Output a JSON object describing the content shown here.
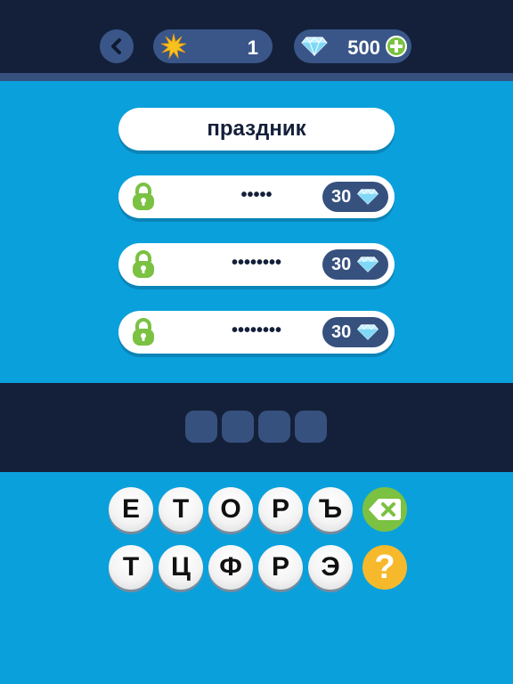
{
  "header": {
    "level_value": "1",
    "gems_value": "500"
  },
  "word": "праздник",
  "hints": [
    {
      "mask": "•••••",
      "price": "30"
    },
    {
      "mask": "••••••••",
      "price": "30"
    },
    {
      "mask": "••••••••",
      "price": "30"
    }
  ],
  "keyboard": {
    "row1": [
      "Е",
      "Т",
      "О",
      "Р",
      "Ъ"
    ],
    "row2": [
      "Т",
      "Ц",
      "Ф",
      "Р",
      "Э"
    ],
    "help_symbol": "?"
  },
  "icons": {
    "back": "chevron-left-icon",
    "level": "star-burst-icon",
    "gems": "diamond-icon",
    "add": "plus-icon",
    "lock": "padlock-icon",
    "delete": "delete-icon",
    "help": "question-icon"
  },
  "colors": {
    "background": "#0aa0dc",
    "dark_bar": "#14203a",
    "pill": "#3a5689",
    "lock_green": "#7bc142",
    "help_yellow": "#f7b92c"
  }
}
